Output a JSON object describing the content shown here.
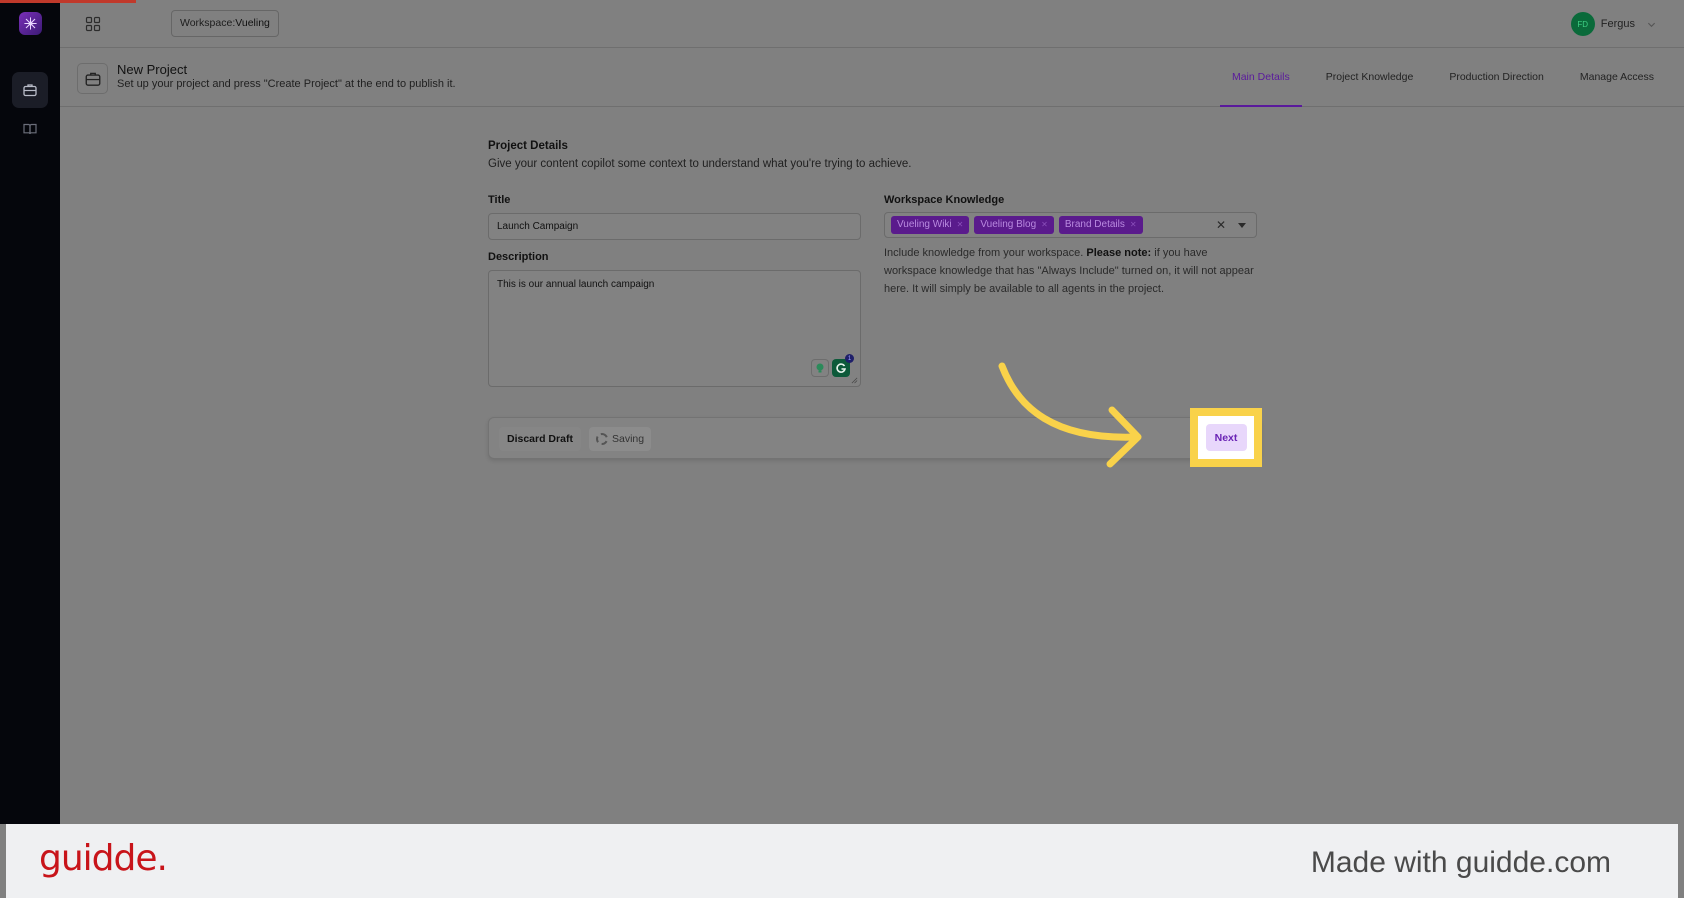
{
  "topbar": {
    "workspace_label": "Workspace:",
    "workspace_name": "Vueling",
    "user_initials": "FD",
    "user_name": "Fergus"
  },
  "header": {
    "title": "New Project",
    "subtitle": "Set up your project and press \"Create Project\" at the end to publish it.",
    "tabs": [
      {
        "label": "Main Details",
        "active": true
      },
      {
        "label": "Project Knowledge",
        "active": false
      },
      {
        "label": "Production Direction",
        "active": false
      },
      {
        "label": "Manage Access",
        "active": false
      }
    ]
  },
  "form": {
    "section_title": "Project Details",
    "section_desc": "Give your content copilot some context to understand what you're trying to achieve.",
    "title_label": "Title",
    "title_value": "Launch Campaign",
    "description_label": "Description",
    "description_value": "This is our annual launch campaign",
    "ai_badge_count": "1",
    "knowledge_label": "Workspace Knowledge",
    "knowledge_chips": [
      "Vueling Wiki",
      "Vueling Blog",
      "Brand Details"
    ],
    "knowledge_help_prefix": "Include knowledge from your workspace. ",
    "knowledge_help_bold": "Please note:",
    "knowledge_help_suffix": " if you have workspace knowledge that has \"Always Include\" turned on, it will not appear here. It will simply be available to all agents in the project."
  },
  "actions": {
    "discard_label": "Discard Draft",
    "saving_label": "Saving",
    "next_label": "Next"
  },
  "footer": {
    "brand": "guidde.",
    "made_with": "Made with guidde.com"
  },
  "colors": {
    "accent": "#5a1a9c",
    "highlight": "#f9d24a",
    "chip_bg": "#5a1b8c",
    "brand_red": "#c8141a"
  },
  "icons": {
    "logo": "app-logo-icon",
    "sidebar": [
      "briefcase-icon",
      "book-icon"
    ],
    "apps": "grid-icon"
  }
}
